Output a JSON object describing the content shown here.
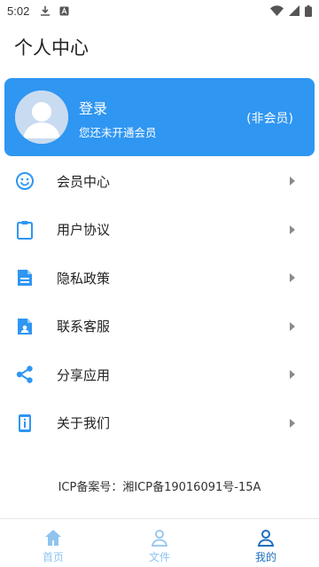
{
  "status_bar": {
    "time": "5:02"
  },
  "page": {
    "title": "个人中心"
  },
  "profile": {
    "name": "登录",
    "subtitle": "您还未开通会员",
    "member_status": "(非会员)"
  },
  "menu": {
    "items": [
      {
        "label": "会员中心",
        "icon": "smiley-icon"
      },
      {
        "label": "用户协议",
        "icon": "clipboard-icon"
      },
      {
        "label": "隐私政策",
        "icon": "document-icon"
      },
      {
        "label": "联系客服",
        "icon": "contact-file-icon"
      },
      {
        "label": "分享应用",
        "icon": "share-icon"
      },
      {
        "label": "关于我们",
        "icon": "info-device-icon"
      }
    ]
  },
  "footer": {
    "icp": "ICP备案号：湘ICP备19016091号-15A"
  },
  "bottom_nav": {
    "items": [
      {
        "label": "首页",
        "icon": "home-icon"
      },
      {
        "label": "文件",
        "icon": "person-outline-icon"
      },
      {
        "label": "我的",
        "icon": "person-icon",
        "active": true
      }
    ]
  },
  "colors": {
    "accent": "#2f96f2",
    "nav_inactive": "#8fc4f0",
    "nav_active": "#1e6fc0"
  }
}
